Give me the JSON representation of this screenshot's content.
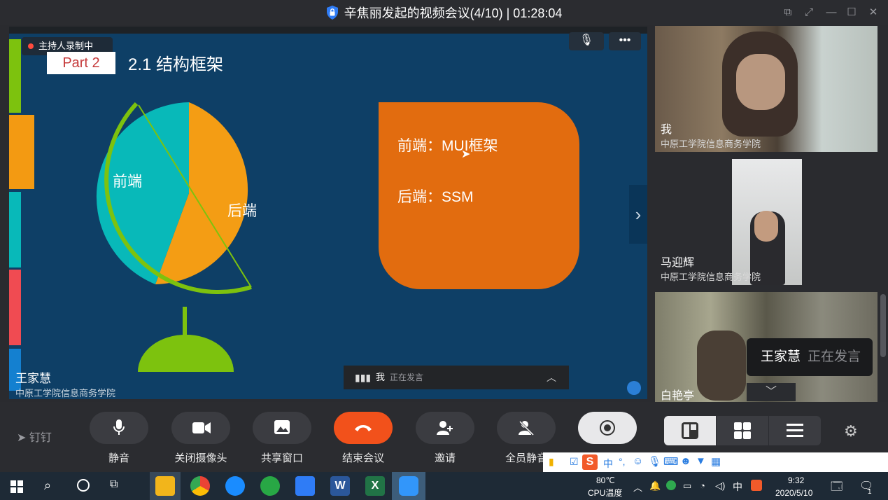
{
  "window": {
    "title": "辛焦丽发起的视频会议(4/10) | 01:28:04"
  },
  "share": {
    "recording_label": "主持人录制中",
    "slide": {
      "part_label": "Part 2",
      "title": "2.1 结构框架",
      "pie_labels": [
        "前端",
        "后端"
      ],
      "box_lines": [
        "前端：MUI框架",
        "后端：SSM"
      ]
    },
    "presenter_name": "王家慧",
    "presenter_org": "中原工学院信息商务学院",
    "speaking_bar": {
      "name": "我",
      "status": "正在发言"
    }
  },
  "participants": [
    {
      "name": "我",
      "org": "中原工学院信息商务学院"
    },
    {
      "name": "马迎辉",
      "org": "中原工学院信息商务学院"
    },
    {
      "name": "白艳亭",
      "org": ""
    }
  ],
  "speaking_popup": {
    "name": "王家慧",
    "status": "正在发言"
  },
  "controls": {
    "brand": "钉钉",
    "buttons": [
      "静音",
      "关闭摄像头",
      "共享窗口",
      "结束会议",
      "邀请",
      "全员静音"
    ],
    "layout_buttons": [
      "宫格",
      "演讲",
      "列表"
    ],
    "settings": "设置"
  },
  "colors": {
    "end_call": "#f2511b",
    "slide_bg": "#0e3f66",
    "orange": "#e26c0f",
    "teal": "#08b9b9",
    "green": "#83c41b"
  },
  "taskbar": {
    "temp": "80℃",
    "temp_label": "CPU温度",
    "ime_lang": "中",
    "time": "9:32",
    "date": "2020/5/10",
    "notification_count": "1"
  }
}
